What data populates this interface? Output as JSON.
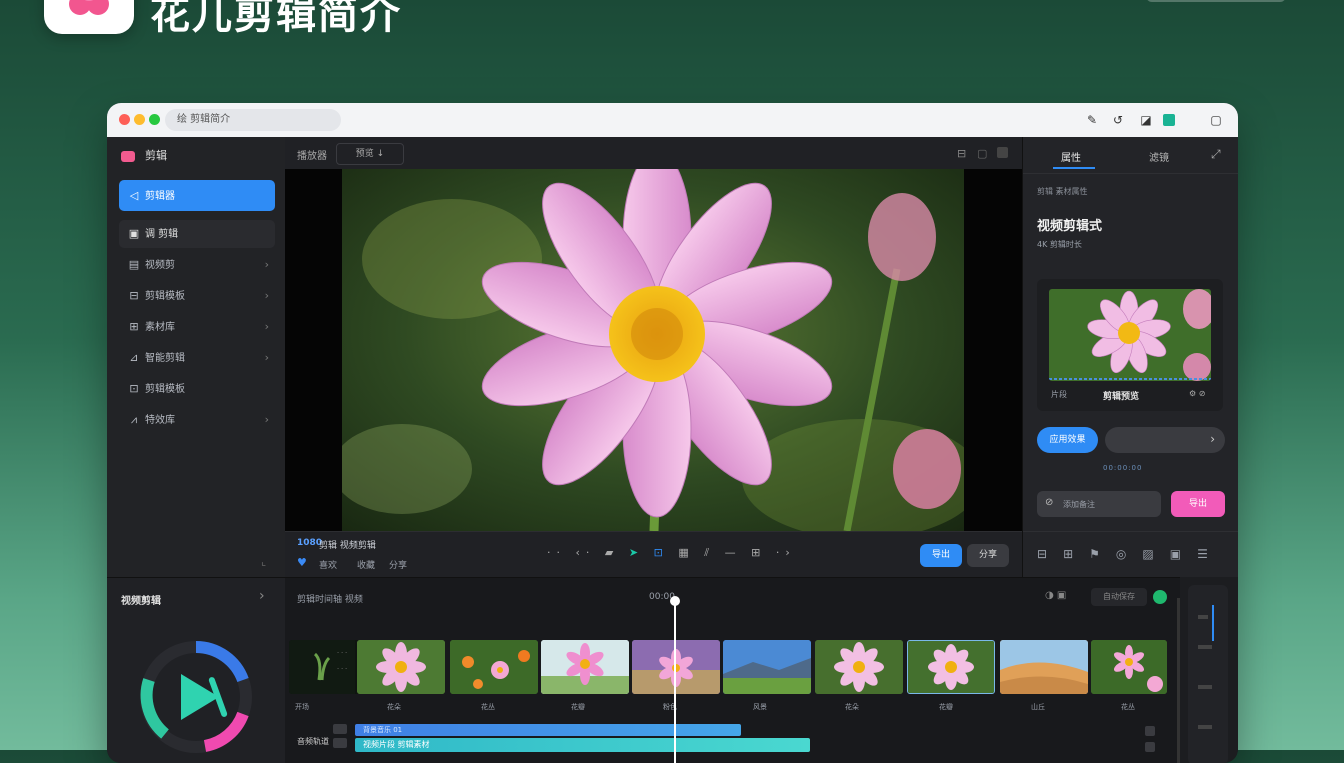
{
  "brand": {
    "title": "花儿剪辑简介",
    "logo_icon": "flower-logo-icon"
  },
  "window": {
    "url": "绘 剪辑简介",
    "toolbar_icons": [
      "edit-icon",
      "history-icon",
      "paint-icon",
      "app-icon",
      "window-icon"
    ]
  },
  "sidebar": {
    "title": "剪辑",
    "items": [
      {
        "label": "剪辑器",
        "icon": "back-icon",
        "active": true
      },
      {
        "label": "调 剪辑",
        "icon": "app-icon"
      },
      {
        "label": "视频剪",
        "icon": "media-icon"
      },
      {
        "label": "剪辑模板",
        "icon": "template-icon"
      },
      {
        "label": "素材库",
        "icon": "library-icon"
      },
      {
        "label": "智能剪辑",
        "icon": "chart-icon"
      },
      {
        "label": "剪辑模板",
        "icon": "grid-icon"
      },
      {
        "label": "特效库",
        "icon": "effect-icon"
      }
    ]
  },
  "center": {
    "label": "播放器",
    "dropdown": "预览 ↓"
  },
  "controls": {
    "resolution": "1080",
    "title": "剪辑 视频剪辑",
    "sub": [
      "喜欢",
      "收藏",
      "分享"
    ],
    "primary_btn": "导出",
    "secondary_btn": "分享"
  },
  "rpanel": {
    "tabs": [
      "属性",
      "滤镜"
    ],
    "section": "剪辑 素材属性",
    "heading": "视频剪辑式",
    "sub": "4K 剪辑时长",
    "card_left": "片段",
    "card_center": "剪辑预览",
    "btn_apply": "应用效果",
    "progress_label": "00:00:00",
    "input_placeholder": "添加备注",
    "btn_pink": "导出",
    "bottom_icons": [
      "layout-icon",
      "grid-icon",
      "flag-icon",
      "globe-icon",
      "image-icon",
      "text-icon",
      "list-icon"
    ]
  },
  "timeline": {
    "left_title": "视频剪辑",
    "header": "剪辑时间轴 视频",
    "playhead_label": "00:00",
    "right_label": "自动保存",
    "frame_labels": [
      "开场",
      "花朵",
      "花丛",
      "花瓣",
      "粉色",
      "风景",
      "花朵",
      "花瓣",
      "山丘",
      "花丛"
    ],
    "track_label": "音频轨道",
    "clip1": "背景音乐 01",
    "clip2": "视频片段 剪辑素材",
    "accent": "#2f8cf5",
    "pink": "#f25bb9"
  }
}
